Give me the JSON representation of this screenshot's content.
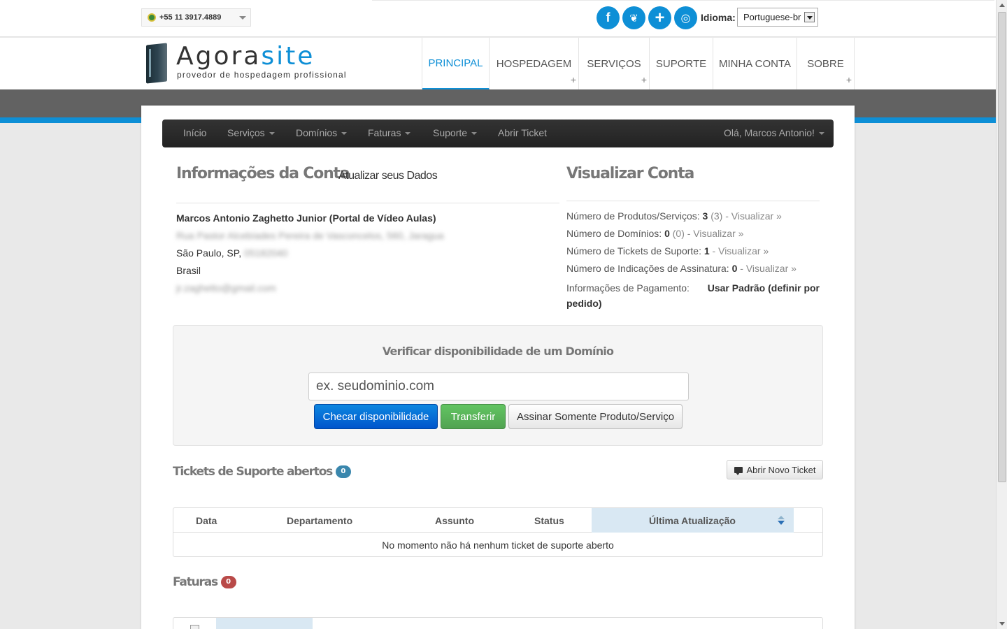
{
  "topbar": {
    "phone": "+55 11 3917.4889",
    "social": [
      {
        "icon": "facebook-icon",
        "glyph": "f"
      },
      {
        "icon": "twitter-icon",
        "glyph": "❦"
      },
      {
        "icon": "plus-icon",
        "glyph": "+"
      },
      {
        "icon": "rss-icon",
        "glyph": "◎"
      }
    ],
    "language_label": "Idioma:",
    "language_value": "Portuguese-br"
  },
  "header": {
    "logo_main": "Agora",
    "logo_accent": "site",
    "tagline": "provedor de hospedagem profissional",
    "nav": [
      {
        "label": "PRINCIPAL",
        "active": true,
        "plus": false
      },
      {
        "label": "HOSPEDAGEM",
        "active": false,
        "plus": true
      },
      {
        "label": "SERVIÇOS",
        "active": false,
        "plus": true
      },
      {
        "label": "SUPORTE",
        "active": false,
        "plus": false
      },
      {
        "label": "MINHA CONTA",
        "active": false,
        "plus": false
      },
      {
        "label": "SOBRE",
        "active": false,
        "plus": true
      }
    ],
    "plus_glyph": "+"
  },
  "subnav": {
    "items": [
      "Início",
      "Serviços",
      "Domínios",
      "Faturas",
      "Suporte",
      "Abrir Ticket"
    ],
    "greeting": "Olá, Marcos Antonio!"
  },
  "account": {
    "title": "Informações da Conta",
    "update_link": "Atualizar seus Dados",
    "name": "Marcos Antonio Zaghetto Junior (Portal de Vídeo Aulas)",
    "address_blurred": "Rua Pastor Alcebíades Pereira de Vasconcelos, 560, Jaragua",
    "city": "São Paulo, SP, ",
    "zip_blurred": "05182040",
    "country": "Brasil",
    "email_blurred": "jr.zaghetto@gmail.com"
  },
  "overview": {
    "title": "Visualizar Conta",
    "stats": [
      {
        "label": "Número de Produtos/Serviços: ",
        "count": "3",
        "extra": " (3)",
        "link": " - Visualizar »"
      },
      {
        "label": "Número de Domínios: ",
        "count": "0",
        "extra": " (0)",
        "link": " - Visualizar »"
      },
      {
        "label": "Número de Tickets de Suporte: ",
        "count": "1",
        "extra": "",
        "link": " - Visualizar »"
      },
      {
        "label": "Número de Indicações de Assinatura: ",
        "count": "0",
        "extra": "",
        "link": " - Visualizar »"
      }
    ],
    "payment_label": "Informações de Pagamento:",
    "payment_value_1": "Usar Padrão (definir por",
    "payment_value_2": "pedido)"
  },
  "domain": {
    "title": "Verificar disponibilidade de um Domínio",
    "input_value": "ex. seudominio.com",
    "check_button": "Checar disponibilidade",
    "transfer_button": "Transferir",
    "product_button": "Assinar Somente Produto/Serviço"
  },
  "tickets": {
    "title": "Tickets de Suporte abertos",
    "count": "0",
    "new_button": "Abrir Novo Ticket",
    "columns": [
      "Data",
      "Departamento",
      "Assunto",
      "Status",
      "Última Atualização"
    ],
    "empty_message": "No momento não há nenhum ticket de suporte aberto"
  },
  "invoices": {
    "title": "Faturas",
    "count": "0"
  },
  "colors": {
    "accent": "#0e8fd6",
    "badge_blue": "#3a87ad",
    "badge_red": "#b94a48"
  }
}
